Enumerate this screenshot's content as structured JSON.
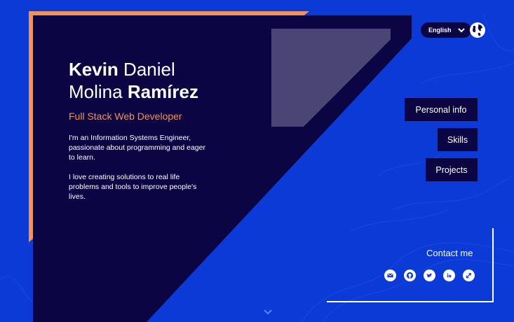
{
  "profile": {
    "first_name": "Kevin",
    "middle_name": "Daniel",
    "last_name_first": "Molina",
    "last_name_second": "Ramírez",
    "role": "Full Stack Web Developer",
    "bio": [
      "I'm an Information Systems Engineer, passionate about programming and eager to learn.",
      "I love creating solutions to real life problems and tools to improve people's lives."
    ]
  },
  "language": {
    "selected": "English",
    "icon": "chevron-down-icon"
  },
  "nav": {
    "personal_info": "Personal info",
    "skills": "Skills",
    "projects": "Projects"
  },
  "contact": {
    "title": "Contact me",
    "icons": [
      "email-icon",
      "github-icon",
      "twitter-icon",
      "linkedin-icon",
      "external-profile-icon"
    ]
  },
  "colors": {
    "background": "#0c3ad6",
    "panel": "#0b0544",
    "accent": "#f0935a",
    "photo_placeholder": "#4a4574"
  }
}
